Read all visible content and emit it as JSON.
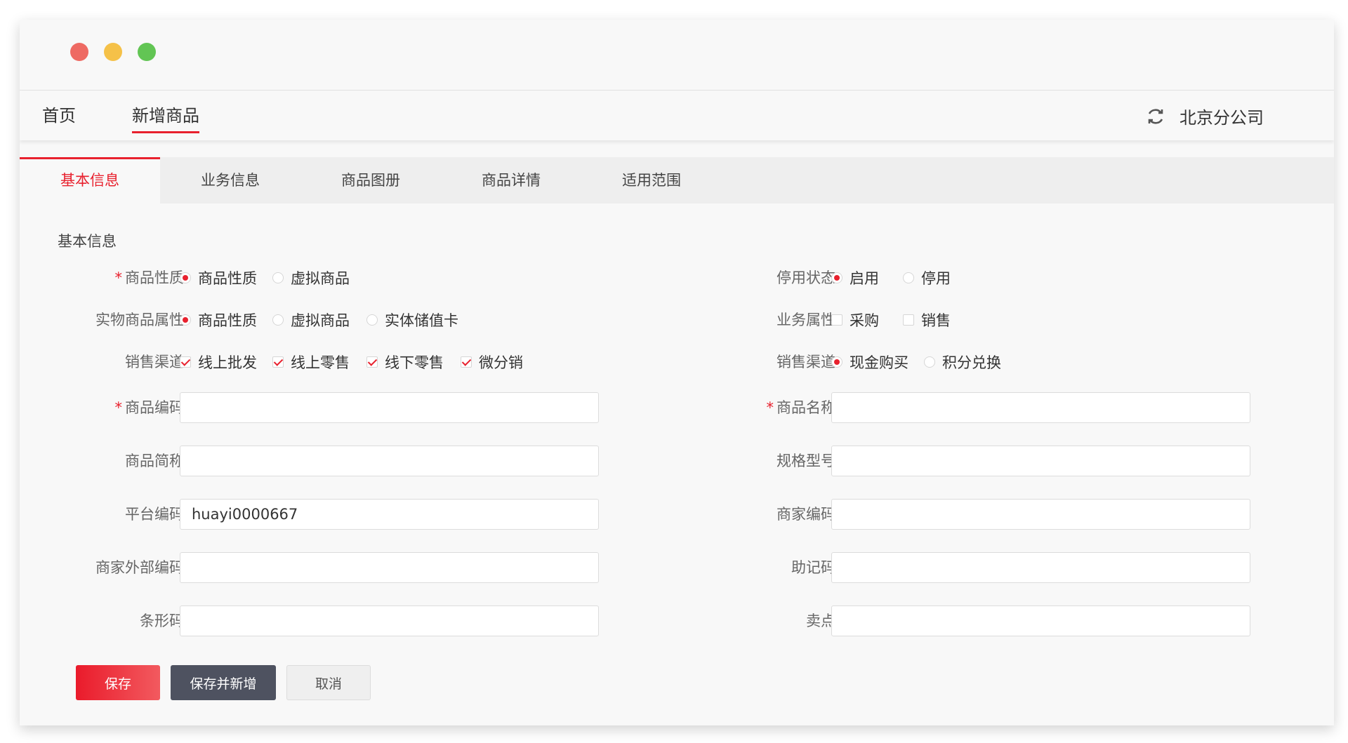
{
  "nav": {
    "home": "首页",
    "active_tab": "新增商品",
    "company": "北京分公司"
  },
  "subtabs": [
    "基本信息",
    "业务信息",
    "商品图册",
    "商品详情",
    "适用范围"
  ],
  "section_title": "基本信息",
  "left": {
    "nature": {
      "label": "商品性质",
      "required": "*",
      "options": [
        "商品性质",
        "虚拟商品"
      ],
      "selected": "商品性质"
    },
    "physical_attr": {
      "label": "实物商品属性",
      "options": [
        "商品性质",
        "虚拟商品",
        "实体储值卡"
      ],
      "selected": "商品性质"
    },
    "sales_channel": {
      "label": "销售渠道",
      "options": [
        "线上批发",
        "线上零售",
        "线下零售",
        "微分销"
      ],
      "checked": [
        "线上批发",
        "线上零售",
        "线下零售",
        "微分销"
      ]
    },
    "code": {
      "label": "商品编码",
      "required": "*",
      "value": ""
    },
    "short_name": {
      "label": "商品简称",
      "value": ""
    },
    "platform_code": {
      "label": "平台编码",
      "value": "huayi0000667"
    },
    "merchant_ext_code": {
      "label": "商家外部编码",
      "value": ""
    },
    "barcode": {
      "label": "条形码",
      "value": ""
    }
  },
  "right": {
    "status": {
      "label": "停用状态",
      "options": [
        "启用",
        "停用"
      ],
      "selected": "启用"
    },
    "business_attr": {
      "label": "业务属性",
      "options": [
        "采购",
        "销售"
      ],
      "checked": []
    },
    "sales_channel": {
      "label": "销售渠道",
      "options": [
        "现金购买",
        "积分兑换"
      ],
      "selected": "现金购买"
    },
    "name": {
      "label": "商品名称",
      "required": "*",
      "value": ""
    },
    "spec": {
      "label": "规格型号",
      "value": ""
    },
    "merchant_code": {
      "label": "商家编码",
      "value": ""
    },
    "mnemonic": {
      "label": "助记码",
      "value": ""
    },
    "selling_point": {
      "label": "卖点",
      "value": ""
    }
  },
  "buttons": {
    "save": "保存",
    "save_new": "保存并新增",
    "cancel": "取消"
  },
  "colors": {
    "accent": "#e8212e",
    "dark_button": "#4e5260"
  }
}
